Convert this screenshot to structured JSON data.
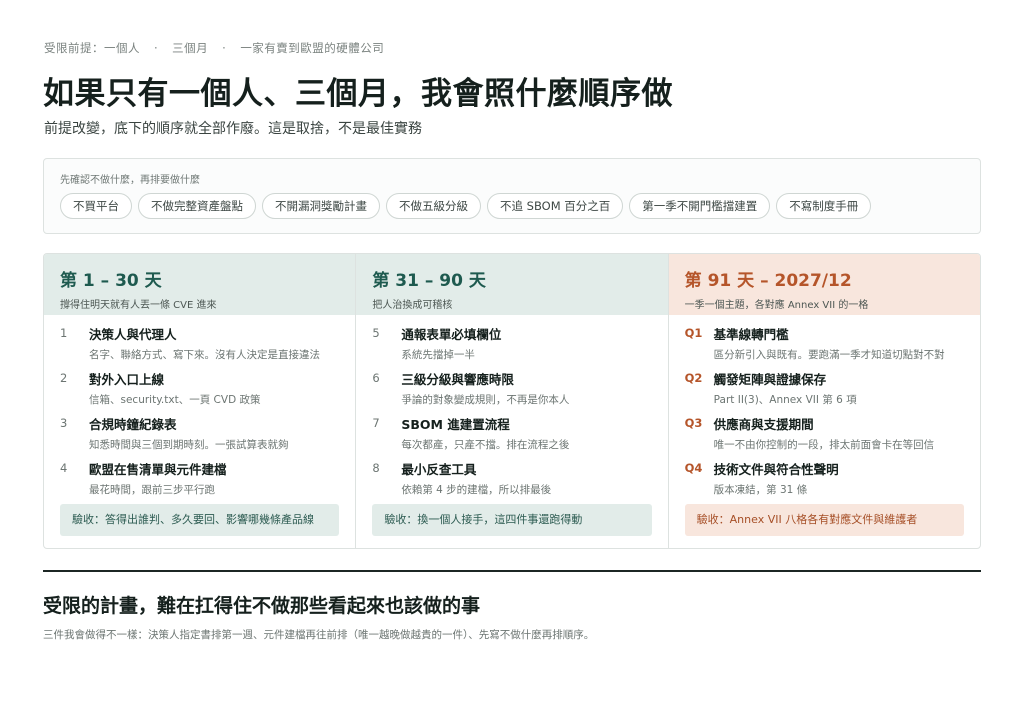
{
  "header": {
    "kicker": [
      "受限前提：一個人",
      "三個月",
      "一家有賣到歐盟的硬體公司"
    ],
    "kicker_separator": "·",
    "title": "如果只有一個人、三個月，我會照什麼順序做",
    "subtitle": "前提改變，底下的順序就全部作廢。這是取捨，不是最佳實務"
  },
  "dont_list": {
    "label": "先確認不做什麼，再排要做什麼",
    "chips": [
      "不買平台",
      "不做完整資產盤點",
      "不開漏洞獎勵計畫",
      "不做五級分級",
      "不追 SBOM 百分之百",
      "第一季不開門檻擋建置",
      "不寫制度手冊"
    ]
  },
  "phases": [
    {
      "title": "第 1 – 30 天",
      "subtitle": "撐得住明天就有人丟一條 CVE 進來",
      "items": [
        {
          "num": "1",
          "title": "決策人與代理人",
          "desc": "名字、聯絡方式、寫下來。沒有人決定是直接違法"
        },
        {
          "num": "2",
          "title": "對外入口上線",
          "desc": "信箱、security.txt、一頁 CVD 政策"
        },
        {
          "num": "3",
          "title": "合規時鐘紀錄表",
          "desc": "知悉時間與三個到期時刻。一張試算表就夠"
        },
        {
          "num": "4",
          "title": "歐盟在售清單與元件建檔",
          "desc": "最花時間，跟前三步平行跑"
        }
      ],
      "acceptance": "驗收：答得出誰判、多久要回、影響哪幾條產品線"
    },
    {
      "title": "第 31 – 90 天",
      "subtitle": "把人治換成可稽核",
      "items": [
        {
          "num": "5",
          "title": "通報表單必填欄位",
          "desc": "系統先擋掉一半"
        },
        {
          "num": "6",
          "title": "三級分級與響應時限",
          "desc": "爭論的對象變成規則，不再是你本人"
        },
        {
          "num": "7",
          "title": "SBOM 進建置流程",
          "desc": "每次都產，只產不擋。排在流程之後"
        },
        {
          "num": "8",
          "title": "最小反查工具",
          "desc": "依賴第 4 步的建檔，所以排最後"
        }
      ],
      "acceptance": "驗收：換一個人接手，這四件事還跑得動"
    },
    {
      "title": "第 91 天 – 2027/12",
      "subtitle": "一季一個主題，各對應 Annex VII 的一格",
      "items": [
        {
          "num": "Q1",
          "title": "基準線轉門檻",
          "desc": "區分新引入與既有。要跑滿一季才知道切點對不對"
        },
        {
          "num": "Q2",
          "title": "觸發矩陣與證據保存",
          "desc": "Part II(3)、Annex VII 第 6 項"
        },
        {
          "num": "Q3",
          "title": "供應商與支援期間",
          "desc": "唯一不由你控制的一段，排太前面會卡在等回信"
        },
        {
          "num": "Q4",
          "title": "技術文件與符合性聲明",
          "desc": "版本凍結，第 31 條"
        }
      ],
      "acceptance": "驗收：Annex VII 八格各有對應文件與維護者"
    }
  ],
  "footer": {
    "title": "受限的計畫，難在扛得住不做那些看起來也該做的事",
    "text": "三件我會做得不一樣：決策人指定書排第一週、元件建檔再往前排（唯一越晚做越貴的一件）、先寫不做什麼再排順序。"
  }
}
